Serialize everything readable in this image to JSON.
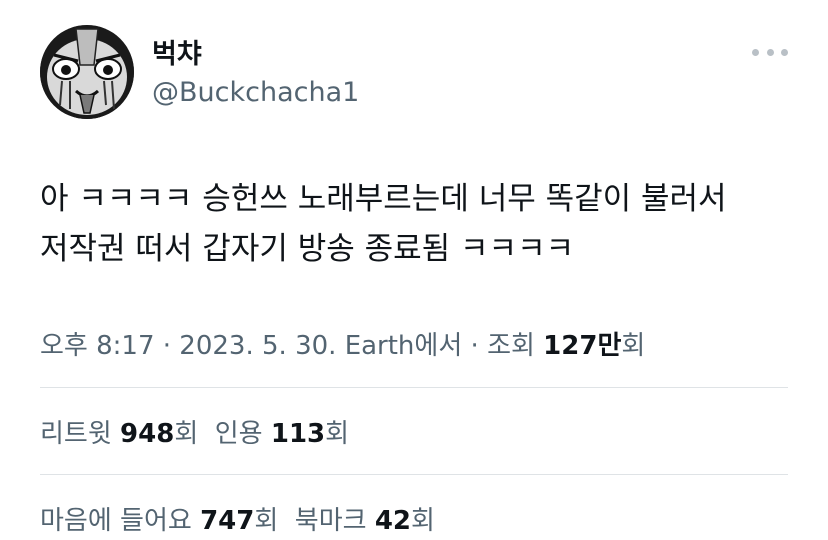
{
  "author": {
    "display_name": "벅챠",
    "handle": "@Buckchacha1"
  },
  "tweet": {
    "line1": "아 ㅋㅋㅋㅋ 승헌쓰 노래부르는데 너무 똑같이 불러서",
    "line2": "저작권 떠서 갑자기 방송 종료됨 ㅋㅋㅋㅋ"
  },
  "meta": {
    "time": "오후 8:17",
    "sep1": " · ",
    "date": "2023. 5. 30.",
    "source_prefix": " ",
    "source": "Earth",
    "source_suffix": "에서",
    "sep2": " · ",
    "views_label": "조회 ",
    "views_value": "127만",
    "views_unit": "회"
  },
  "stats": {
    "retweets_label": "리트윗 ",
    "retweets_value": "948",
    "retweets_unit": "회",
    "quotes_label": "인용 ",
    "quotes_value": "113",
    "quotes_unit": "회",
    "likes_label": "마음에 들어요 ",
    "likes_value": "747",
    "likes_unit": "회",
    "bookmarks_label": "북마크 ",
    "bookmarks_value": "42",
    "bookmarks_unit": "회"
  },
  "icons": {
    "more": "more-dots-icon"
  }
}
